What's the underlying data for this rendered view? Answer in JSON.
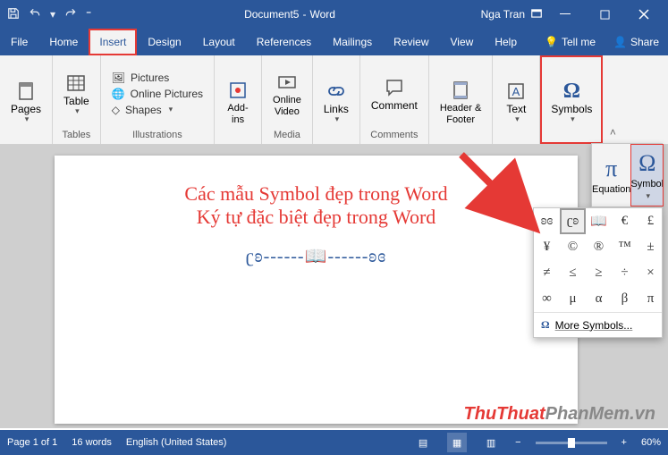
{
  "title": {
    "doc": "Document5",
    "app": "Word"
  },
  "user": "Nga Tran",
  "menus": [
    "File",
    "Home",
    "Insert",
    "Design",
    "Layout",
    "References",
    "Mailings",
    "Review",
    "View",
    "Help",
    "Tell me",
    "Share"
  ],
  "ribbon": {
    "groups": {
      "pages": {
        "label": "Pages",
        "btn": "Pages"
      },
      "tables": {
        "label": "Tables",
        "btn": "Table"
      },
      "illustrations": {
        "label": "Illustrations",
        "pictures": "Pictures",
        "online": "Online Pictures",
        "shapes": "Shapes"
      },
      "addins": {
        "label": "Add-ins",
        "btn": "Add-\nins"
      },
      "media": {
        "label": "Media",
        "btn": "Online\nVideo"
      },
      "links": {
        "label": "Links",
        "btn": "Links"
      },
      "comments": {
        "label": "Comments",
        "btn": "Comment"
      },
      "hf": {
        "label": "Header & Footer",
        "btn": "Header &\nFooter"
      },
      "text": {
        "label": "Text",
        "btn": "Text"
      },
      "symbols": {
        "label": "Symbols",
        "btn": "Symbols"
      }
    }
  },
  "document": {
    "line1": "Các mẫu Symbol đẹp trong Word",
    "line2": "Ký tự đặc biệt đẹp trong Word",
    "deco": "ʗʚ------📖------ʚɞ"
  },
  "flyout1": {
    "equation": "Equation",
    "symbol": "Symbol",
    "pi": "π",
    "omega": "Ω"
  },
  "symbols_grid": [
    [
      "ʚɞ",
      "ʗʚ",
      "📖",
      "€",
      "£"
    ],
    [
      "¥",
      "©",
      "®",
      "™",
      "±"
    ],
    [
      "≠",
      "≤",
      "≥",
      "÷",
      "×"
    ],
    [
      "∞",
      "μ",
      "α",
      "β",
      "π"
    ]
  ],
  "more_symbols": "More Symbols...",
  "statusbar": {
    "page": "Page 1 of 1",
    "words": "16 words",
    "lang": "English (United States)",
    "zoom": "60%"
  },
  "watermark": {
    "a": "ThuThuat",
    "b": "PhanMem",
    "c": ".vn"
  }
}
